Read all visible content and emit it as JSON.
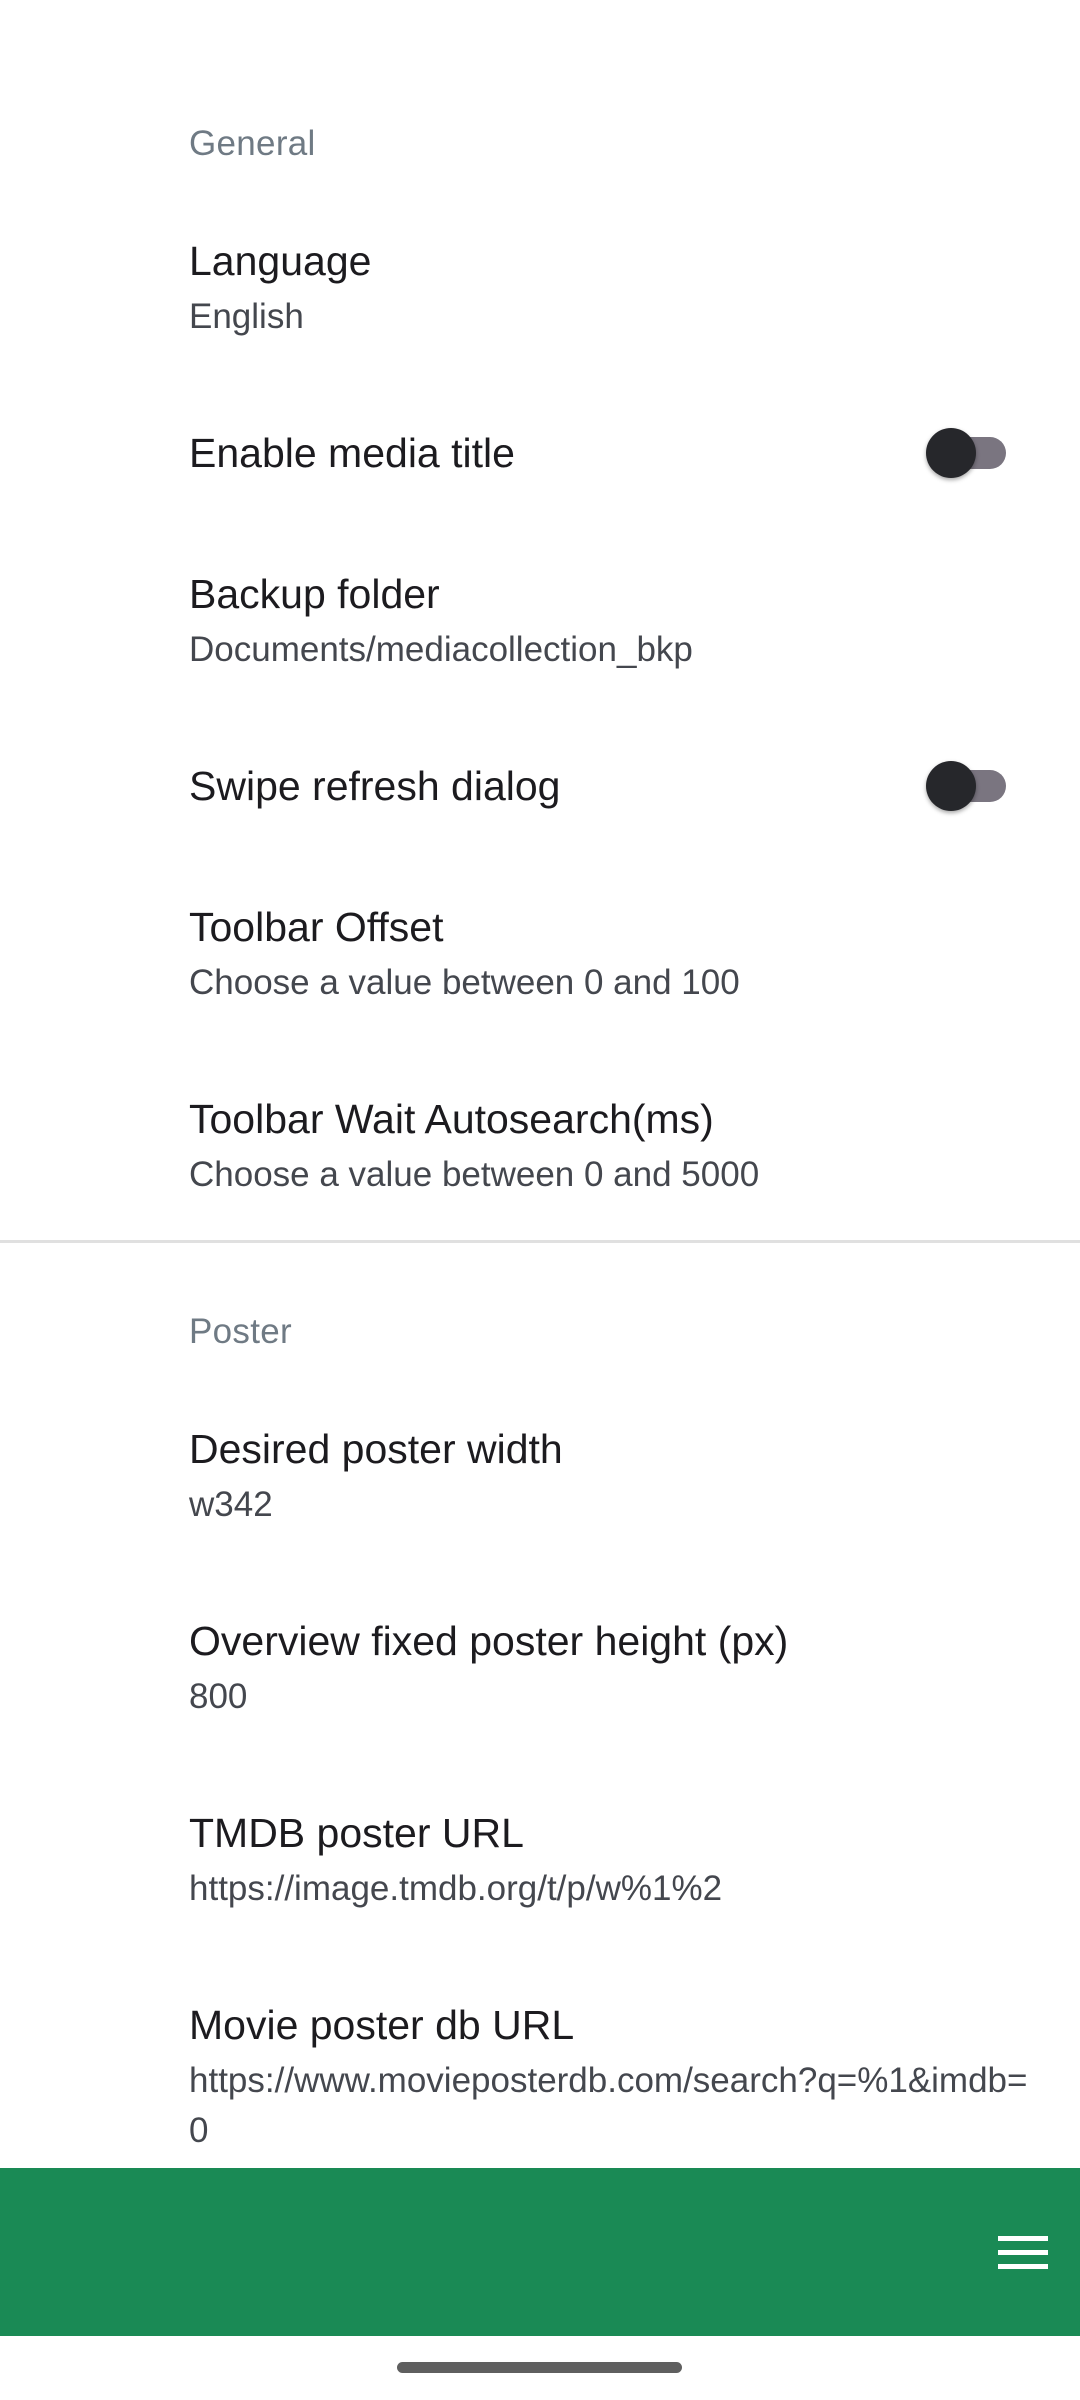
{
  "sections": {
    "general": {
      "header": "General",
      "language": {
        "title": "Language",
        "summary": "English"
      },
      "enable_media_title": {
        "title": "Enable media title",
        "enabled": false
      },
      "backup_folder": {
        "title": "Backup folder",
        "summary": "Documents/mediacollection_bkp"
      },
      "swipe_refresh_dialog": {
        "title": "Swipe refresh dialog",
        "enabled": false
      },
      "toolbar_offset": {
        "title": "Toolbar Offset",
        "summary": "Choose a value between 0 and 100"
      },
      "toolbar_wait_autosearch": {
        "title": "Toolbar Wait Autosearch(ms)",
        "summary": "Choose a value between 0 and 5000"
      }
    },
    "poster": {
      "header": "Poster",
      "desired_poster_width": {
        "title": "Desired poster width",
        "summary": "w342"
      },
      "overview_poster_height": {
        "title": "Overview fixed poster height (px)",
        "summary": "800"
      },
      "tmdb_poster_url": {
        "title": "TMDB poster URL",
        "summary": "https://image.tmdb.org/t/p/w%1%2"
      },
      "movie_poster_db_url": {
        "title": "Movie poster db URL",
        "summary": "https://www.movieposterdb.com/search?q=%1&imdb=0"
      }
    }
  },
  "bottom_bar": {
    "color": "#1a8a55",
    "menu_icon": "hamburger-menu-icon"
  }
}
